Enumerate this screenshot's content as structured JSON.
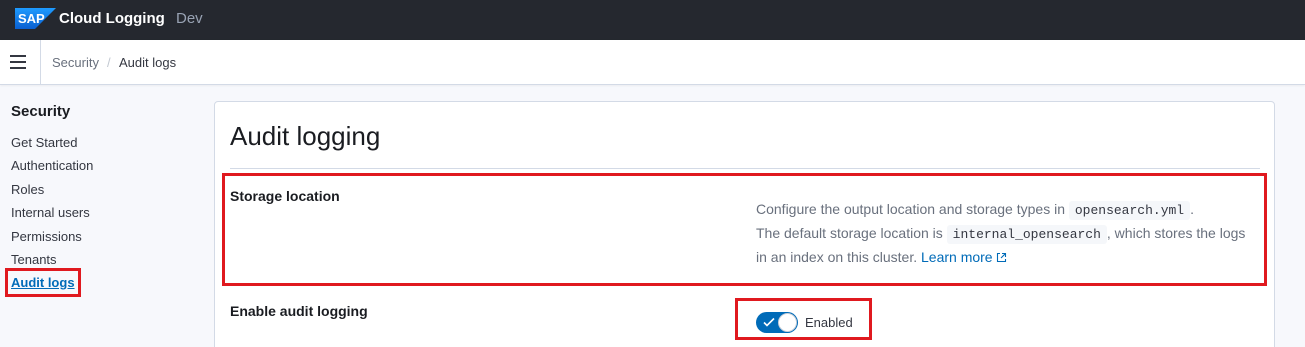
{
  "topbar": {
    "logo": "SAP",
    "app_name": "Cloud Logging",
    "env": "Dev"
  },
  "breadcrumb": {
    "parent": "Security",
    "separator": "/",
    "current": "Audit logs"
  },
  "sidebar": {
    "title": "Security",
    "items": [
      {
        "label": "Get Started"
      },
      {
        "label": "Authentication"
      },
      {
        "label": "Roles"
      },
      {
        "label": "Internal users"
      },
      {
        "label": "Permissions"
      },
      {
        "label": "Tenants"
      },
      {
        "label": "Audit logs",
        "active": true
      }
    ]
  },
  "main": {
    "title": "Audit logging",
    "storage": {
      "label": "Storage location",
      "desc_part1": "Configure the output location and storage types in",
      "code1": "opensearch.yml",
      "desc_part2": ".",
      "desc_part3": "The default storage location is",
      "code2": "internal_opensearch",
      "desc_part4": ", which stores the logs in an index on this cluster.",
      "link_text": "Learn more"
    },
    "enable": {
      "label": "Enable audit logging",
      "toggle_state": true,
      "toggle_label": "Enabled"
    }
  },
  "colors": {
    "accent": "#006bb8",
    "highlight": "#e0191f",
    "topbar": "#25282f"
  },
  "icons": {
    "menu": "hamburger-icon",
    "external": "external-link-icon",
    "check": "check-icon"
  }
}
